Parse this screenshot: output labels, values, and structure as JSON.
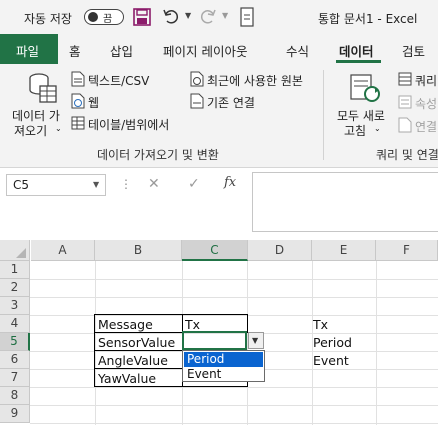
{
  "titlebar": {
    "autosave_label": "자동 저장",
    "autosave_state": "끔",
    "document_title": "통합 문서1  -  Excel"
  },
  "tabs": {
    "file": "파일",
    "items": [
      "홈",
      "삽입",
      "페이지 레이아웃",
      "수식",
      "데이터",
      "검토"
    ],
    "active": "데이터"
  },
  "ribbon": {
    "get_data_label_1": "데이터 가",
    "get_data_label_2": "져오기",
    "text_csv": "텍스트/CSV",
    "web": "웹",
    "table_range": "테이블/범위에서",
    "recent_sources": "최근에 사용한 원본",
    "existing_connections": "기존 연결",
    "group_get_transform": "데이터 가져오기 및 변환",
    "refresh_all_1": "모두 새로",
    "refresh_all_2": "고침",
    "queries": "쿼리",
    "properties": "속성",
    "edit_links": "연결",
    "group_queries": "쿼리 및 연결"
  },
  "formula_bar": {
    "name_box": "C5",
    "formula": "",
    "fx": "fx"
  },
  "sheet": {
    "columns": [
      "A",
      "B",
      "C",
      "D",
      "E",
      "F"
    ],
    "selected_column": "C",
    "rows": [
      "1",
      "2",
      "3",
      "4",
      "5",
      "6",
      "7",
      "8",
      "9"
    ],
    "selected_row": "5",
    "cells": {
      "B4": "Message",
      "B5": "SensorValue",
      "B6": "AngleValue",
      "B7": "YawValue",
      "C4": "Tx",
      "E4": "Tx",
      "E5": "Period",
      "E6": "Event"
    }
  },
  "validation_dropdown": {
    "options": [
      "Period",
      "Event"
    ],
    "highlighted": "Period"
  },
  "colors": {
    "excel_green": "#217346",
    "highlight_blue": "#0a64d0",
    "save_icon": "#8b1b6a"
  }
}
